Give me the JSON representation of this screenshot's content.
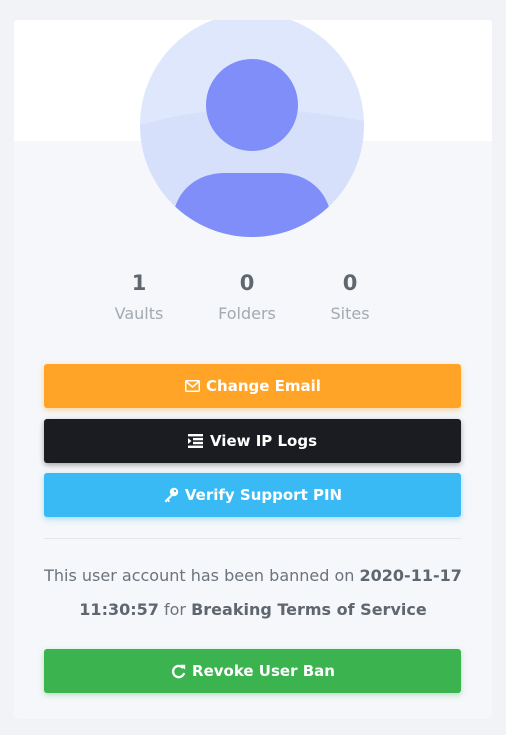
{
  "profile": {
    "avatar_icon": "user-avatar-icon",
    "colors": {
      "avatar_bg": "#dfe7fc",
      "avatar_fg": "#7f8ef8"
    }
  },
  "stats": [
    {
      "value": "1",
      "label": "Vaults"
    },
    {
      "value": "0",
      "label": "Folders"
    },
    {
      "value": "0",
      "label": "Sites"
    }
  ],
  "actions": {
    "change_email": {
      "label": "Change Email",
      "icon": "envelope-icon",
      "color": "#ffa426"
    },
    "view_ip_logs": {
      "label": "View IP Logs",
      "icon": "list-icon",
      "color": "#1a1c21"
    },
    "verify_pin": {
      "label": "Verify Support PIN",
      "icon": "key-icon",
      "color": "#3abaf4"
    },
    "revoke_ban": {
      "label": "Revoke User Ban",
      "icon": "redo-icon",
      "color": "#3bb44f"
    }
  },
  "ban_notice": {
    "prefix": "This user account has been banned on",
    "date": "2020-11-17",
    "time": "11:30:57",
    "middle": "for",
    "reason": "Breaking Terms of Service"
  }
}
